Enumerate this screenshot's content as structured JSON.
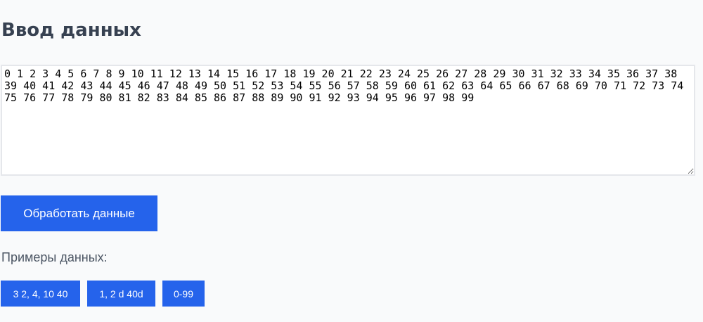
{
  "header": {
    "title": "Ввод данных"
  },
  "input": {
    "value": "0 1 2 3 4 5 6 7 8 9 10 11 12 13 14 15 16 17 18 19 20 21 22 23 24 25 26 27 28 29 30 31 32 33 34 35 36 37 38 39 40 41 42 43 44 45 46 47 48 49 50 51 52 53 54 55 56 57 58 59 60 61 62 63 64 65 66 67 68 69 70 71 72 73 74 75 76 77 78 79 80 81 82 83 84 85 86 87 88 89 90 91 92 93 94 95 96 97 98 99"
  },
  "process_button": {
    "label": "Обработать данные"
  },
  "examples": {
    "label": "Примеры данных:",
    "items": [
      {
        "label": "3 2, 4, 10 40"
      },
      {
        "label": "1, 2 d 40d"
      },
      {
        "label": "0-99"
      }
    ]
  },
  "colors": {
    "accent": "#2563eb",
    "heading": "#374151",
    "background": "#f9fafb"
  }
}
